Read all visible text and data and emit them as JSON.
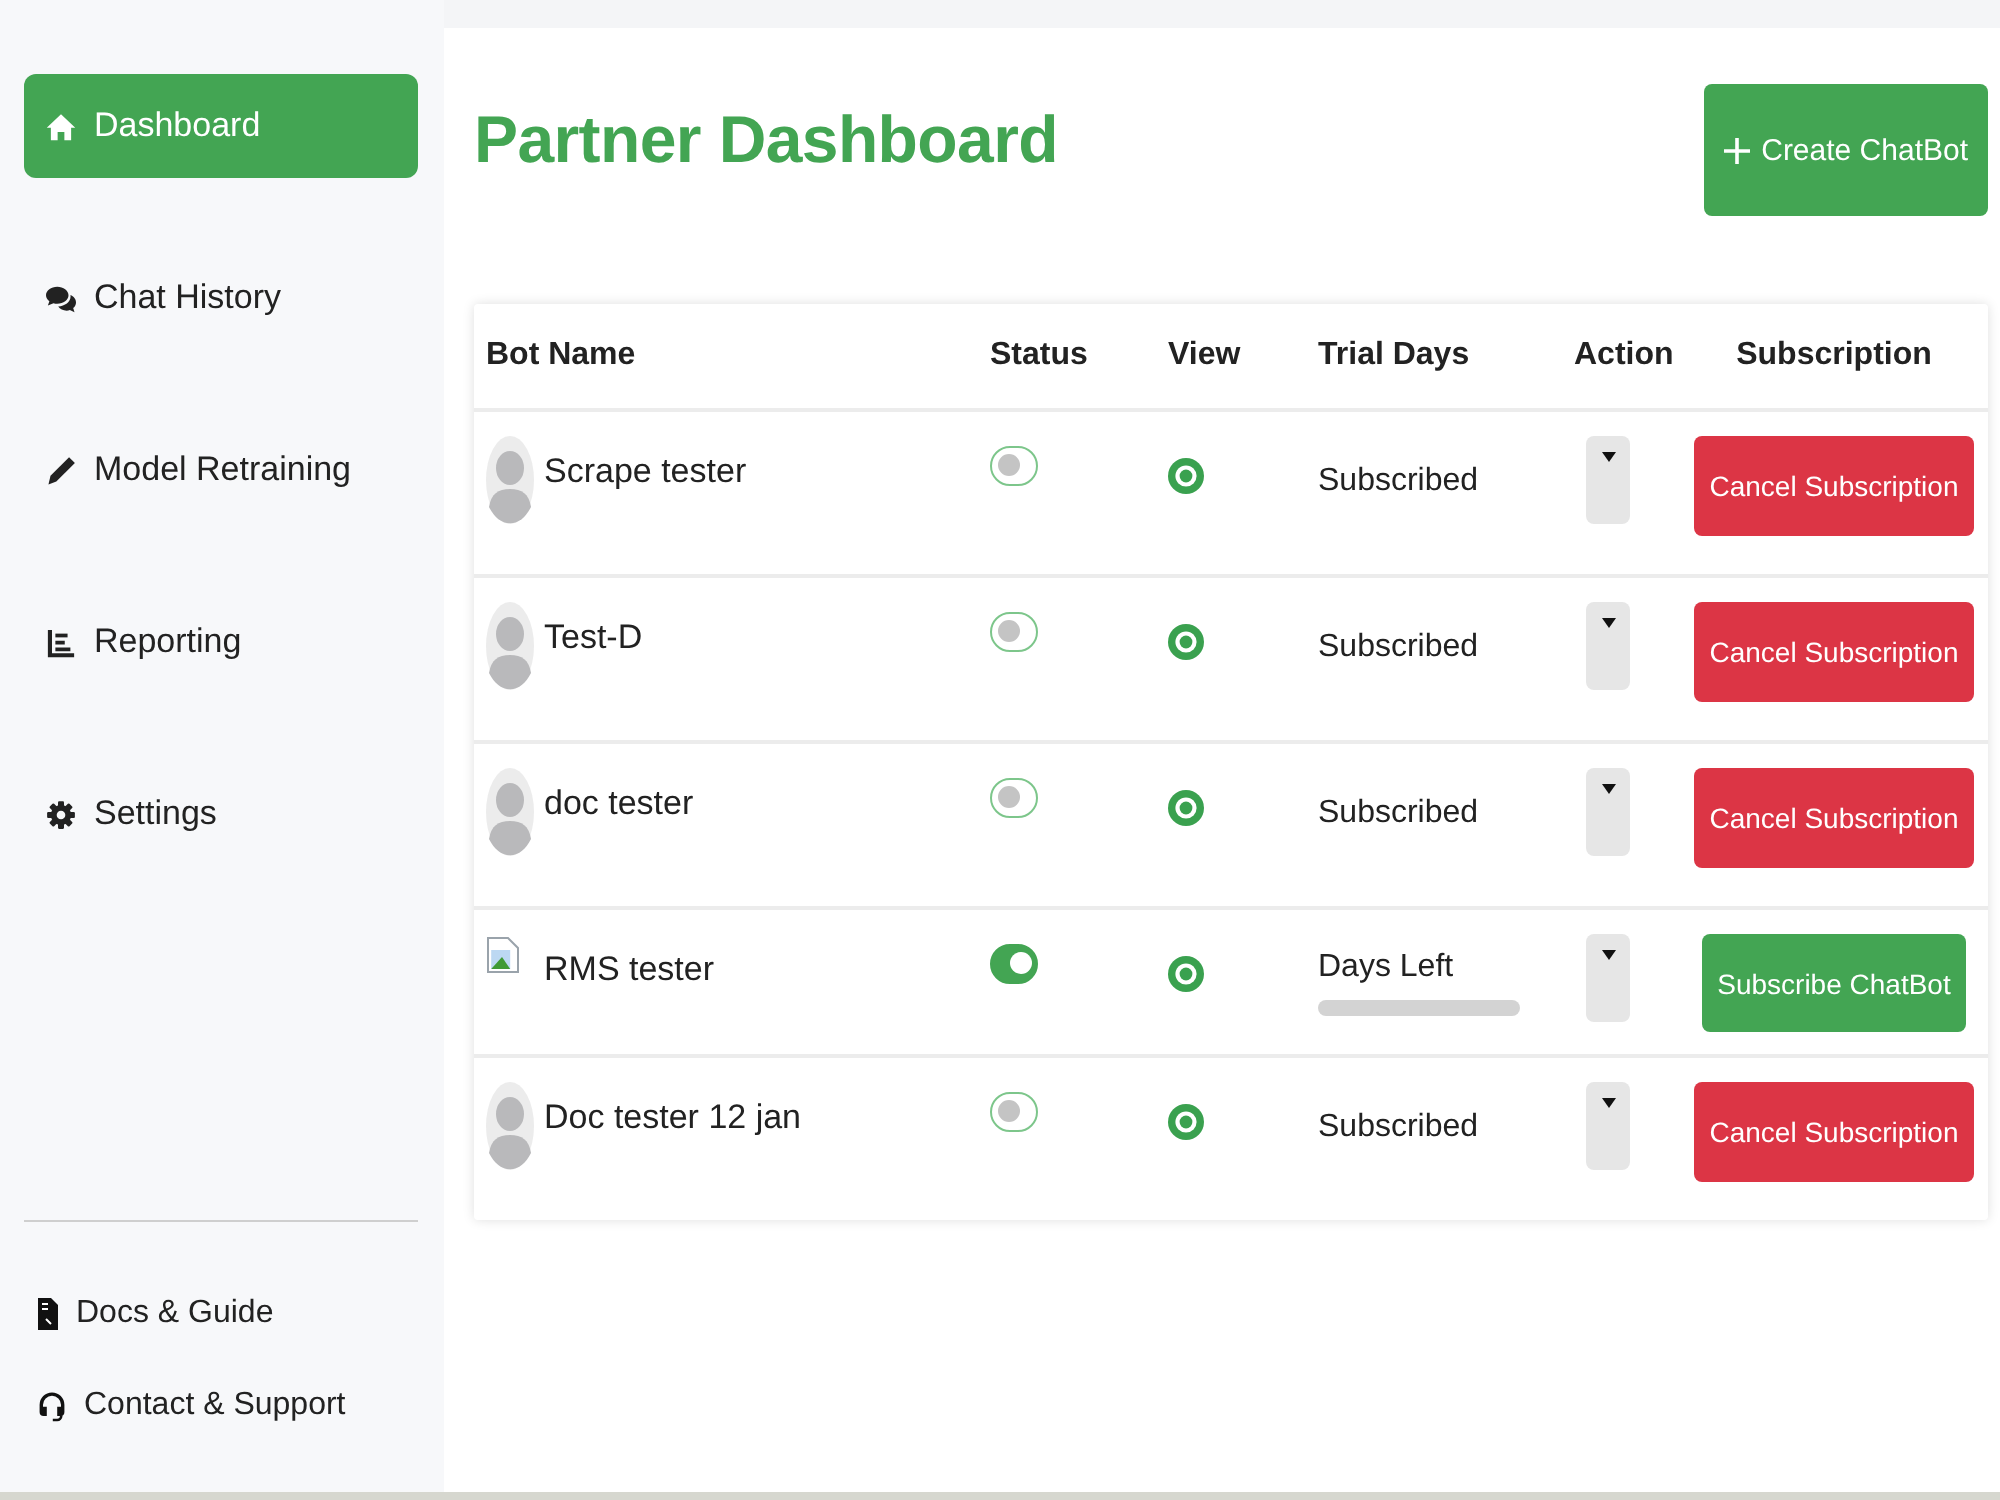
{
  "sidebar": {
    "items": [
      {
        "label": "Dashboard",
        "selected": true
      },
      {
        "label": "Chat History",
        "selected": false
      },
      {
        "label": "Model Retraining",
        "selected": false
      },
      {
        "label": "Reporting",
        "selected": false
      },
      {
        "label": "Settings",
        "selected": false
      }
    ],
    "footer_links": [
      {
        "label": "Docs & Guide"
      },
      {
        "label": "Contact & Support"
      }
    ]
  },
  "header": {
    "title": "Partner Dashboard",
    "create_button": "Create ChatBot"
  },
  "table": {
    "columns": [
      "Bot Name",
      "Status",
      "View",
      "Trial Days",
      "Action",
      "Subscription"
    ],
    "rows": [
      {
        "image_broken": false,
        "name": "Scrape tester",
        "active": false,
        "trial_days": {
          "kind": "text",
          "text": "Subscribed"
        },
        "subscription": {
          "kind": "cancel",
          "label": "Cancel Subscription"
        }
      },
      {
        "image_broken": false,
        "name": "Test-D",
        "active": false,
        "trial_days": {
          "kind": "text",
          "text": "Subscribed"
        },
        "subscription": {
          "kind": "cancel",
          "label": "Cancel Subscription"
        }
      },
      {
        "image_broken": false,
        "name": "doc tester",
        "active": false,
        "trial_days": {
          "kind": "text",
          "text": "Subscribed"
        },
        "subscription": {
          "kind": "cancel",
          "label": "Cancel Subscription"
        }
      },
      {
        "image_broken": true,
        "name": "RMS tester",
        "active": true,
        "trial_days": {
          "kind": "progress",
          "label": "Days Left",
          "level": 0
        },
        "subscription": {
          "kind": "subscribe",
          "label": "Subscribe ChatBot"
        }
      },
      {
        "image_broken": false,
        "name": "Doc tester 12 jan",
        "active": false,
        "trial_days": {
          "kind": "text",
          "text": "Subscribed"
        },
        "subscription": {
          "kind": "cancel",
          "label": "Cancel Subscription"
        }
      }
    ]
  }
}
